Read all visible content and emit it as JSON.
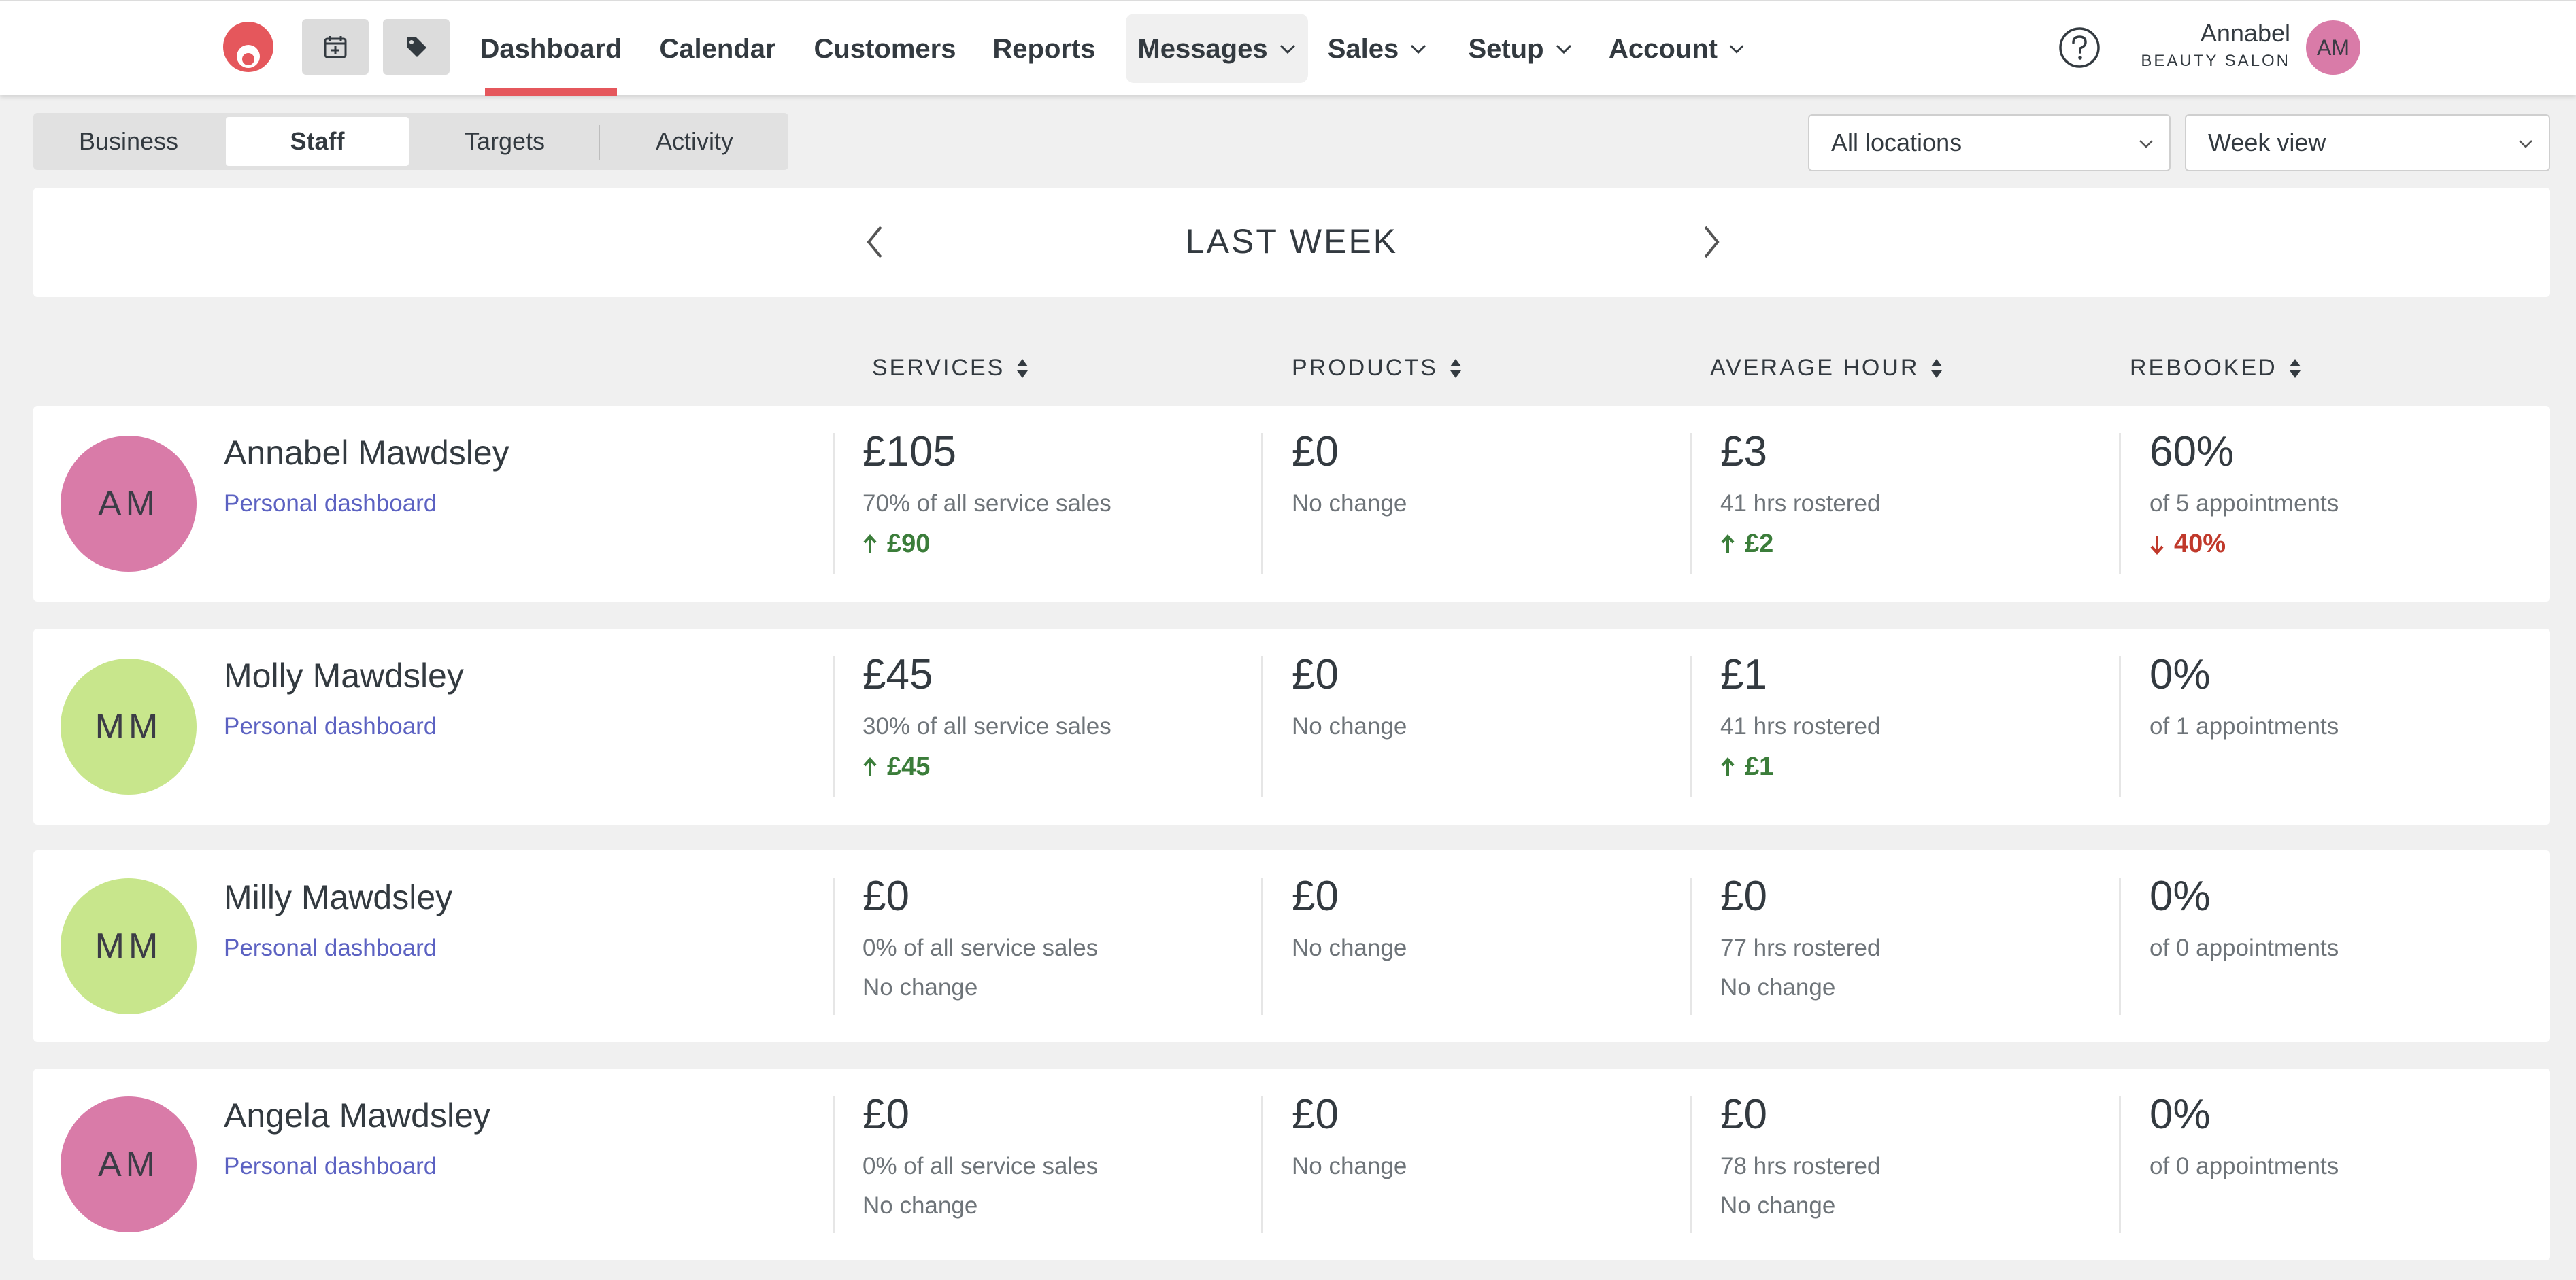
{
  "header": {
    "nav": [
      {
        "label": "Dashboard"
      },
      {
        "label": "Calendar"
      },
      {
        "label": "Customers"
      },
      {
        "label": "Reports"
      },
      {
        "label": "Messages"
      },
      {
        "label": "Sales"
      },
      {
        "label": "Setup"
      },
      {
        "label": "Account"
      }
    ],
    "active_nav": "Dashboard",
    "user": {
      "name": "Annabel",
      "business": "BEAUTY SALON",
      "initials": "AM"
    }
  },
  "subtabs": [
    {
      "label": "Business"
    },
    {
      "label": "Staff"
    },
    {
      "label": "Targets"
    },
    {
      "label": "Activity"
    }
  ],
  "active_subtab": "Staff",
  "filters": {
    "location": "All locations",
    "view": "Week view"
  },
  "period": {
    "label": "LAST WEEK"
  },
  "columns": [
    {
      "label": "SERVICES"
    },
    {
      "label": "PRODUCTS"
    },
    {
      "label": "AVERAGE HOUR"
    },
    {
      "label": "REBOOKED"
    }
  ],
  "colors": {
    "brand": "#e5575c",
    "link": "#5c62c2",
    "positive": "#3b7d3a",
    "negative": "#c0392b",
    "avatar_pink": "#d97ba8",
    "avatar_green": "#c8e68c"
  },
  "staff": [
    {
      "initials": "AM",
      "avatar_color": "#d97ba8",
      "name": "Annabel Mawdsley",
      "link": "Personal dashboard",
      "services": {
        "value": "£105",
        "sub": "70% of all service sales",
        "change": "£90",
        "dir": "up"
      },
      "products": {
        "value": "£0",
        "sub": "No change"
      },
      "average_hour": {
        "value": "£3",
        "sub": "41 hrs rostered",
        "change": "£2",
        "dir": "up"
      },
      "rebooked": {
        "value": "60%",
        "sub": "of 5 appointments",
        "change": "40%",
        "dir": "down"
      }
    },
    {
      "initials": "MM",
      "avatar_color": "#c8e68c",
      "name": "Molly Mawdsley",
      "link": "Personal dashboard",
      "services": {
        "value": "£45",
        "sub": "30% of all service sales",
        "change": "£45",
        "dir": "up"
      },
      "products": {
        "value": "£0",
        "sub": "No change"
      },
      "average_hour": {
        "value": "£1",
        "sub": "41 hrs rostered",
        "change": "£1",
        "dir": "up"
      },
      "rebooked": {
        "value": "0%",
        "sub": "of 1 appointments"
      }
    },
    {
      "initials": "MM",
      "avatar_color": "#c8e68c",
      "name": "Milly Mawdsley",
      "link": "Personal dashboard",
      "services": {
        "value": "£0",
        "sub": "0% of all service sales",
        "change": "No change",
        "dir": "none"
      },
      "products": {
        "value": "£0",
        "sub": "No change"
      },
      "average_hour": {
        "value": "£0",
        "sub": "77 hrs rostered",
        "change": "No change",
        "dir": "none"
      },
      "rebooked": {
        "value": "0%",
        "sub": "of 0 appointments"
      }
    },
    {
      "initials": "AM",
      "avatar_color": "#d97ba8",
      "name": "Angela Mawdsley",
      "link": "Personal dashboard",
      "services": {
        "value": "£0",
        "sub": "0% of all service sales",
        "change": "No change",
        "dir": "none"
      },
      "products": {
        "value": "£0",
        "sub": "No change"
      },
      "average_hour": {
        "value": "£0",
        "sub": "78 hrs rostered",
        "change": "No change",
        "dir": "none"
      },
      "rebooked": {
        "value": "0%",
        "sub": "of 0 appointments"
      }
    }
  ]
}
